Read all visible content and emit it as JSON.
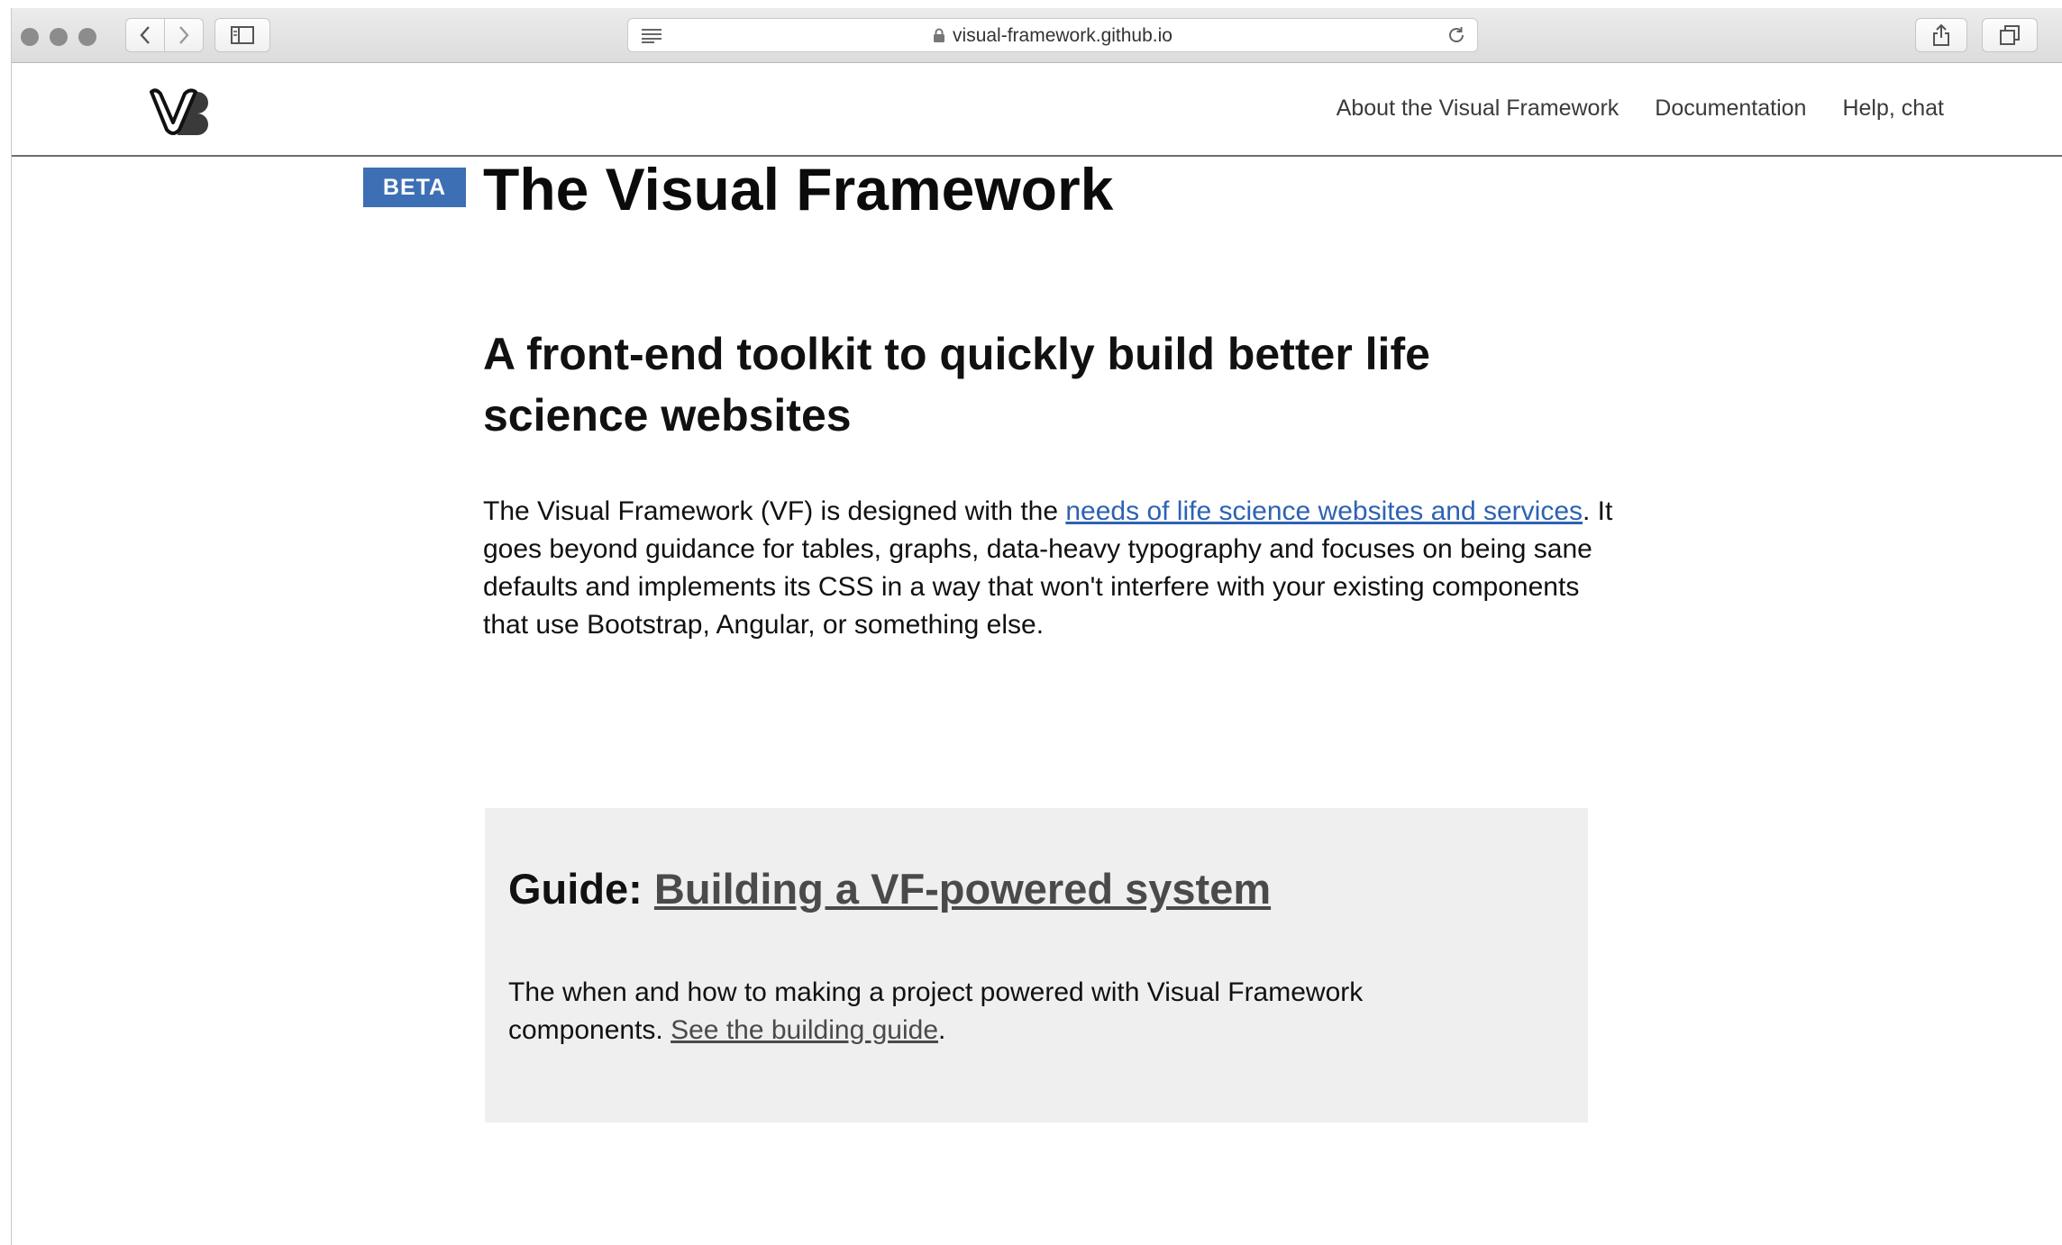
{
  "browser": {
    "url": "visual-framework.github.io",
    "icons": [
      "back-icon",
      "forward-icon",
      "sidebar-icon",
      "reader-icon",
      "lock-icon",
      "reload-icon",
      "share-icon",
      "tabs-icon"
    ]
  },
  "header": {
    "logo_alt": "VF",
    "nav": [
      {
        "label": "About the Visual Framework"
      },
      {
        "label": "Documentation"
      },
      {
        "label": "Help, chat"
      }
    ]
  },
  "hero": {
    "badge": "BETA",
    "title": "The Visual Framework"
  },
  "intro": {
    "heading": "A front-end toolkit to quickly build better life science websites",
    "text_before": "The Visual Framework (VF) is designed with the ",
    "link": "needs of life science websites and services",
    "text_after": ". It goes beyond guidance for tables, graphs, data-heavy typography and focuses on being sane defaults and implements its CSS in a way that won't interfere with your existing components that use Bootstrap, Angular, or something else."
  },
  "guide": {
    "label": "Guide: ",
    "link": "Building a VF-powered system",
    "text": "The when and how to making a project powered with Visual Framework components. ",
    "body_link": "See the building guide",
    "end": "."
  },
  "colors": {
    "badge": "#3d6fb5",
    "link": "#2d62b3",
    "guide_bg": "#efefef"
  }
}
